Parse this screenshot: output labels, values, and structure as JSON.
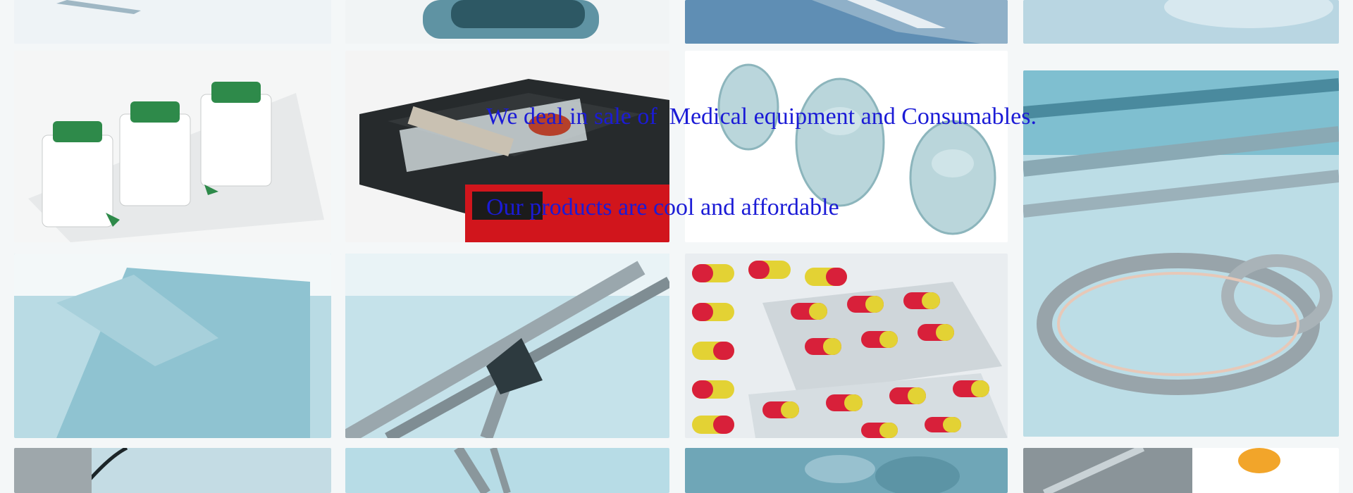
{
  "hero": {
    "line1": "We deal in sale of  Medical equipment and Consumables.",
    "line2": "Our products are cool and affordable",
    "text_color": "#1b1bd6"
  },
  "tiles": [
    {
      "name": "tile-vials"
    },
    {
      "name": "tile-microscope"
    },
    {
      "name": "tile-glass-bottles"
    },
    {
      "name": "tile-scissors"
    },
    {
      "name": "tile-blue-drape"
    },
    {
      "name": "tile-forceps"
    },
    {
      "name": "tile-capsule-blisters"
    }
  ]
}
